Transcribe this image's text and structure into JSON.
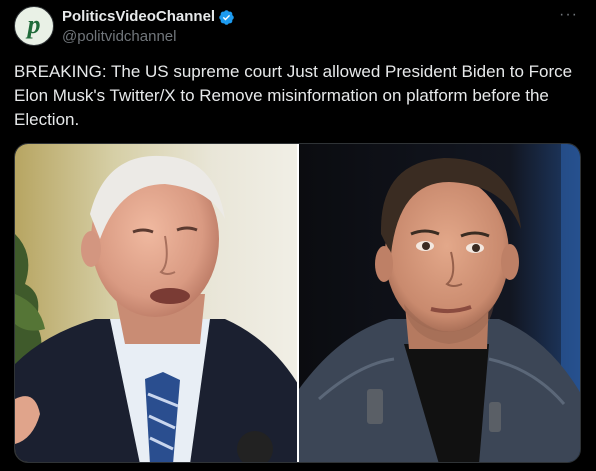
{
  "author": {
    "display_name": "PoliticsVideoChannel",
    "handle": "@politvidchannel",
    "avatar_letter": "p",
    "verified": true
  },
  "more_icon": "···",
  "tweet": {
    "text": "BREAKING: The US supreme court Just allowed President Biden to Force Elon Musk's Twitter/X to Remove misinformation on platform before the Election."
  },
  "media": {
    "left_photo": "older-man-in-suit-photo",
    "right_photo": "man-in-leather-jacket-photo"
  },
  "colors": {
    "background": "#000000",
    "text_primary": "#e7e9ea",
    "text_secondary": "#71767b",
    "verified_blue": "#1d9bf0"
  }
}
